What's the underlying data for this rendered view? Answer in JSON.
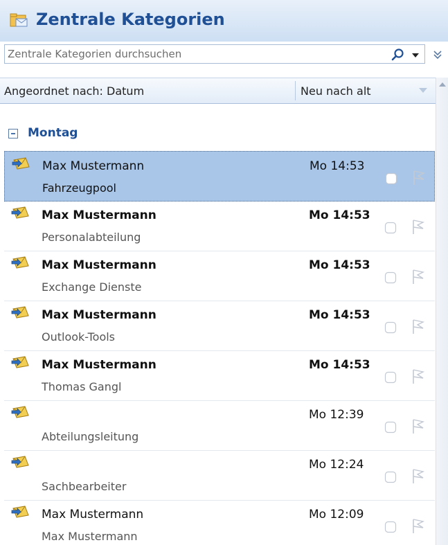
{
  "header": {
    "title": "Zentrale Kategorien",
    "icon": "folder-envelope-icon"
  },
  "search": {
    "placeholder": "Zentrale Kategorien durchsuchen",
    "value": ""
  },
  "sort": {
    "by_label": "Angeordnet nach: Datum",
    "order_label": "Neu nach alt"
  },
  "group": {
    "label": "Montag",
    "toggle_symbol": "−"
  },
  "messages": [
    {
      "sender": "Max Mustermann",
      "subject": "Fahrzeugpool",
      "time": "Mo 14:53",
      "unread": false,
      "selected": true
    },
    {
      "sender": "Max Mustermann",
      "subject": "Personalabteilung",
      "time": "Mo 14:53",
      "unread": true,
      "selected": false
    },
    {
      "sender": "Max Mustermann",
      "subject": "Exchange Dienste",
      "time": "Mo 14:53",
      "unread": true,
      "selected": false
    },
    {
      "sender": "Max Mustermann",
      "subject": "Outlook-Tools",
      "time": "Mo 14:53",
      "unread": true,
      "selected": false
    },
    {
      "sender": "Max Mustermann",
      "subject": "Thomas Gangl",
      "time": "Mo 14:53",
      "unread": true,
      "selected": false
    },
    {
      "sender": "",
      "subject": "Abteilungsleitung",
      "time": "Mo 12:39",
      "unread": false,
      "selected": false
    },
    {
      "sender": "",
      "subject": "Sachbearbeiter",
      "time": "Mo 12:24",
      "unread": false,
      "selected": false
    },
    {
      "sender": "Max Mustermann",
      "subject": "Max Mustermann",
      "time": "Mo 12:09",
      "unread": false,
      "selected": false
    }
  ],
  "colors": {
    "accent": "#1f4f94",
    "selection": "#a9c6e8",
    "header_bg": "#cddff3"
  }
}
